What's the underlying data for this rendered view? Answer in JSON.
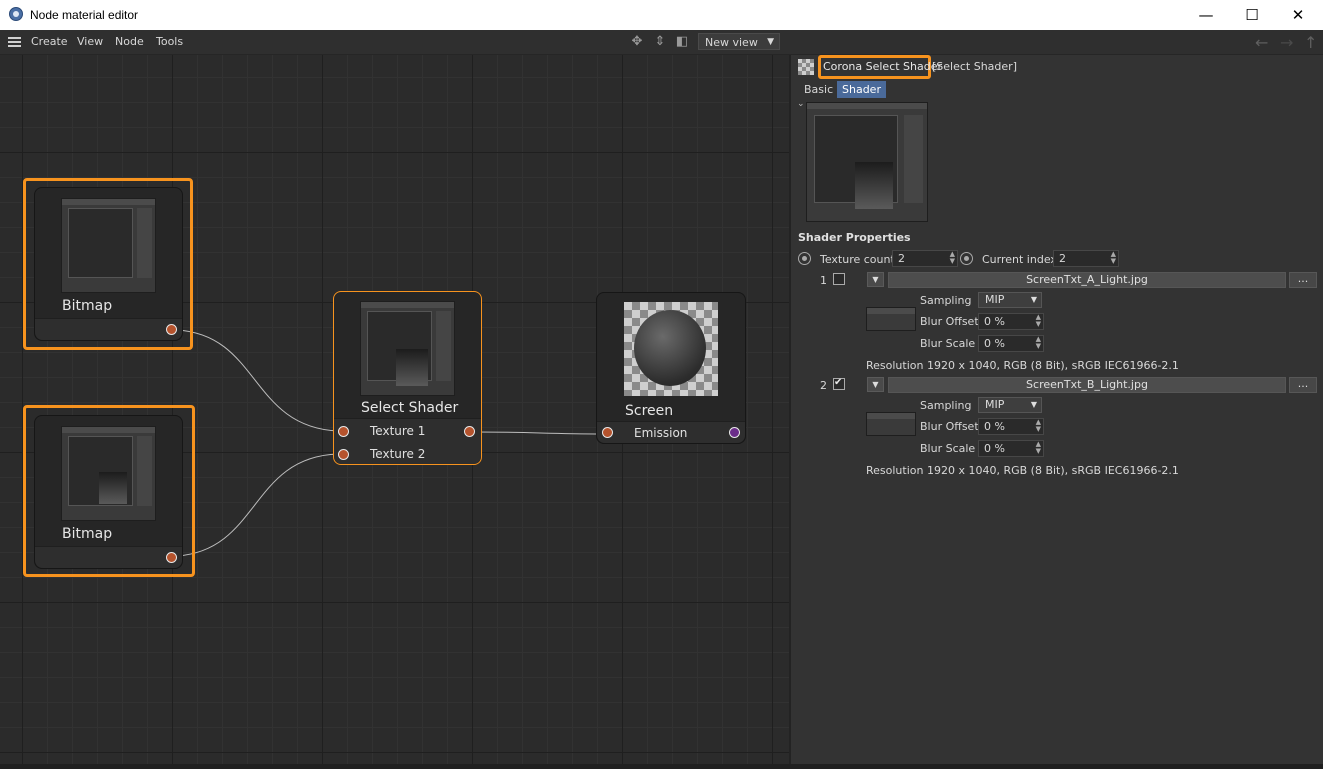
{
  "window": {
    "title": "Node material editor",
    "minimize": "—",
    "maximize": "☐",
    "close": "✕"
  },
  "menu": {
    "items": [
      "Create",
      "View",
      "Node",
      "Tools"
    ]
  },
  "toolbar": {
    "view_select": "New view"
  },
  "nodes": {
    "bitmap1": {
      "title": "Bitmap"
    },
    "bitmap2": {
      "title": "Bitmap"
    },
    "select_shader": {
      "title": "Select Shader",
      "inputs": [
        "Texture 1",
        "Texture 2"
      ]
    },
    "screen": {
      "title": "Screen",
      "input": "Emission"
    }
  },
  "panel": {
    "header_name": "Corona Select Shader",
    "header_suffix": "[Select Shader]",
    "tabs": [
      "Basic",
      "Shader"
    ],
    "active_tab": "Shader",
    "section_title": "Shader Properties",
    "texture_count_label": "Texture count",
    "texture_count_value": "2",
    "current_index_label": "Current index",
    "current_index_value": "2",
    "textures": [
      {
        "index": "1",
        "checked": false,
        "file": "ScreenTxt_A_Light.jpg",
        "sampling_label": "Sampling",
        "sampling_value": "MIP",
        "blur_offset_label": "Blur Offset",
        "blur_offset_value": "0 %",
        "blur_scale_label": "Blur Scale",
        "blur_scale_value": "0 %",
        "resolution": "Resolution 1920 x 1040, RGB (8 Bit), sRGB IEC61966-2.1",
        "more_label": "..."
      },
      {
        "index": "2",
        "checked": true,
        "file": "ScreenTxt_B_Light.jpg",
        "sampling_label": "Sampling",
        "sampling_value": "MIP",
        "blur_offset_label": "Blur Offset",
        "blur_offset_value": "0 %",
        "blur_scale_label": "Blur Scale",
        "blur_scale_value": "0 %",
        "resolution": "Resolution 1920 x 1040, RGB (8 Bit), sRGB IEC61966-2.1",
        "more_label": "..."
      }
    ]
  },
  "colors": {
    "selection": "#f7931e",
    "port_output": "#b5532d",
    "port_purple": "#6b2d8a",
    "tab_active": "#4a6a9a"
  }
}
